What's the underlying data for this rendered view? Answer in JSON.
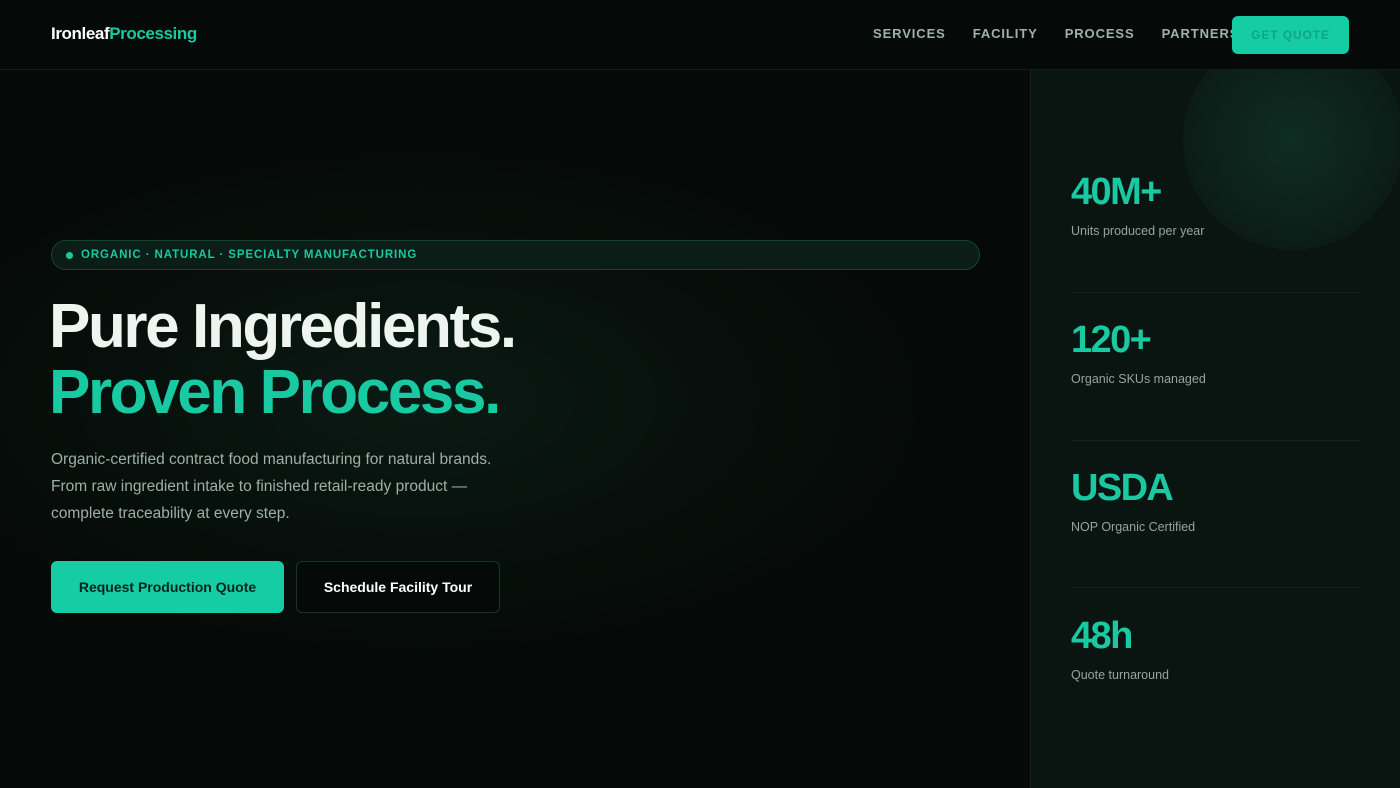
{
  "brand": {
    "part1": "Ironleaf",
    "part2": "Processing"
  },
  "nav": {
    "items": [
      "SERVICES",
      "FACILITY",
      "PROCESS",
      "PARTNERS"
    ],
    "cta": "GET QUOTE"
  },
  "hero": {
    "tag": "ORGANIC · NATURAL · SPECIALTY MANUFACTURING",
    "headline_1": "Pure Ingredients.",
    "headline_2": "Proven Process.",
    "description": [
      "Organic-certified contract food manufacturing for natural brands.",
      "From raw ingredient intake to finished retail-ready product —",
      "complete traceability at every step."
    ],
    "primary_button": "Request Production Quote",
    "secondary_button": "Schedule Facility Tour"
  },
  "stats": [
    {
      "value": "40M+",
      "label": "Units produced per year"
    },
    {
      "value": "120+",
      "label": "Organic SKUs managed"
    },
    {
      "value": "USDA",
      "label": "NOP Organic Certified"
    },
    {
      "value": "48h",
      "label": "Quote turnaround"
    }
  ],
  "colors": {
    "accent": "#18c9a2",
    "background": "#050a08",
    "panel": "#0a1410"
  }
}
